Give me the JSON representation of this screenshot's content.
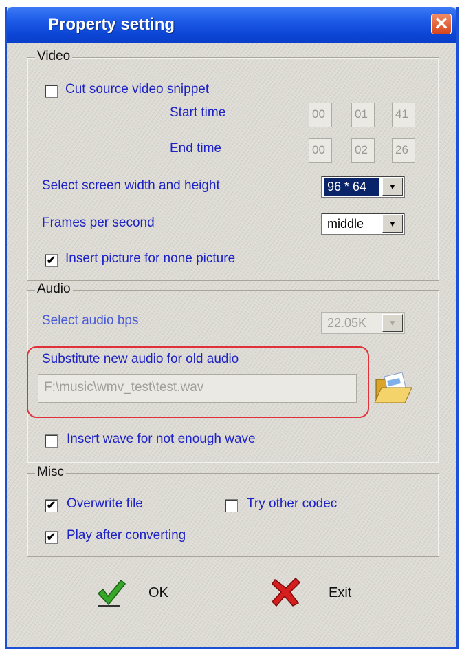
{
  "window": {
    "title": "Property setting",
    "close_label": "✕"
  },
  "video": {
    "label": "Video",
    "cut_snippet": {
      "label": "Cut source video snippet",
      "checked": false,
      "mark": ""
    },
    "start_time": {
      "label": "Start time",
      "h": "00",
      "m": "01",
      "s": "41"
    },
    "end_time": {
      "label": "End time",
      "h": "00",
      "m": "02",
      "s": "26"
    },
    "screen_size": {
      "label": "Select screen width and height",
      "value": "96 * 64"
    },
    "fps": {
      "label": "Frames per second",
      "value": "middle"
    },
    "insert_picture": {
      "label": "Insert picture for none picture",
      "checked": true,
      "mark": "✔"
    }
  },
  "audio": {
    "label": "Audio",
    "bps": {
      "label": "Select audio bps",
      "value": "22.05K"
    },
    "substitute": {
      "label": "Substitute new audio for old audio",
      "path": "F:\\music\\wmv_test\\test.wav"
    },
    "insert_wave": {
      "label": "Insert wave for not enough wave",
      "checked": false,
      "mark": ""
    }
  },
  "misc": {
    "label": "Misc",
    "overwrite": {
      "label": "Overwrite file",
      "checked": true,
      "mark": "✔"
    },
    "try_codec": {
      "label": "Try other codec",
      "checked": false,
      "mark": ""
    },
    "play_after": {
      "label": "Play after converting",
      "checked": true,
      "mark": "✔"
    }
  },
  "buttons": {
    "ok": "OK",
    "exit": "Exit"
  },
  "dropdown_arrow": "▼",
  "icons": {
    "close": "close-icon",
    "folder": "open-folder-icon",
    "ok": "green-checkmark-icon",
    "exit": "red-x-icon"
  },
  "colors": {
    "title_bar": "#0c46d6",
    "label_text": "#1d22c4",
    "highlight": "#e0303a",
    "close_button": "#d6451c"
  }
}
